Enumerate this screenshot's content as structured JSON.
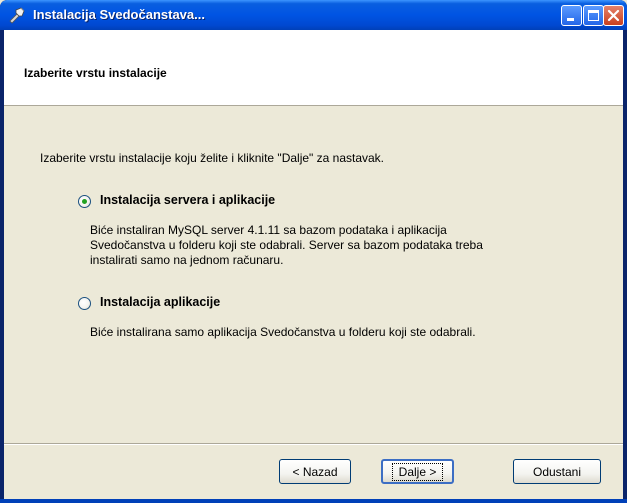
{
  "window": {
    "title": "Instalacija Svedočanstava..."
  },
  "header": {
    "title": "Izaberite vrstu instalacije"
  },
  "intro": "Izaberite vrstu instalacije koju želite i kliknite \"Dalje\" za nastavak.",
  "options": [
    {
      "label": "Instalacija servera i aplikacije",
      "selected": true,
      "description": [
        "Biće instaliran MySQL server 4.1.11 sa bazom podataka i aplikacija",
        "Svedočanstva u folderu koji ste odabrali. Server sa bazom podataka treba",
        "instalirati samo na jednom računaru."
      ]
    },
    {
      "label": "Instalacija aplikacije",
      "selected": false,
      "description": [
        "Biće instalirana samo aplikacija Svedočanstva u folderu koji ste odabrali."
      ]
    }
  ],
  "buttons": {
    "back": "< Nazad",
    "next": "Dalje >",
    "cancel": "Odustani"
  },
  "colors": {
    "titlebar": "#0054e3",
    "face": "#ece9d8",
    "radio_dot": "#21a121"
  }
}
